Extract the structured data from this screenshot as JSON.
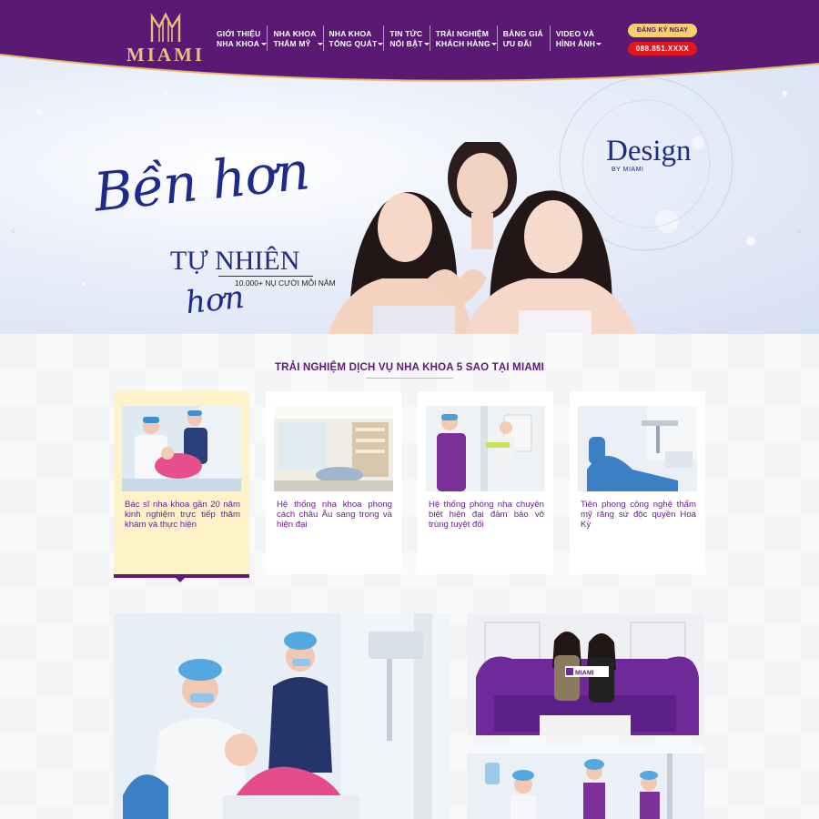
{
  "brand": {
    "name": "MIAMI",
    "gold": "#e6c07a",
    "purple": "#5b1b78"
  },
  "nav": [
    {
      "line1": "GIỚI THIỆU",
      "line2": "NHA KHOA",
      "caret": true
    },
    {
      "line1": "NHA KHOA",
      "line2": "THẨM MỸ",
      "caret": true
    },
    {
      "line1": "NHA KHOA",
      "line2": "TỔNG QUÁT",
      "caret": true
    },
    {
      "line1": "TIN TỨC",
      "line2": "NỔI BẬT",
      "caret": true
    },
    {
      "line1": "TRẢI NGHIỆM",
      "line2": "KHÁCH HÀNG",
      "caret": true
    },
    {
      "line1": "BẢNG GIÁ",
      "line2": "ƯU ĐÃI",
      "caret": false
    },
    {
      "line1": "VIDEO VÀ",
      "line2": "HÌNH ẢNH",
      "caret": true
    }
  ],
  "cta": {
    "register": "ĐĂNG KÝ NGAY",
    "phone": "088.851.XXXX"
  },
  "hero": {
    "script_top": "Bền hơn",
    "headline": "TỰ NHIÊN",
    "sub": "10.000+ NỤ CƯỜI MỖI NĂM",
    "script_bottom": "hơn",
    "design": "Design",
    "design_by": "BY MIAMI",
    "arrow_left": "‹",
    "arrow_right": "›"
  },
  "section": {
    "title": "TRẢI NGHIỆM DỊCH VỤ NHA KHOA 5 SAO TẠI MIAMI",
    "cards": [
      {
        "text": "Bác sĩ nha khoa gần 20 năm kinh nghiệm trực tiếp thăm khám và thực hiện",
        "active": true
      },
      {
        "text": "Hệ thống nha khoa phong cách châu Âu sang trọng và hiện đại",
        "active": false
      },
      {
        "text": "Hệ thống phòng nha chuyên biệt hiện đại đảm bảo vô trùng tuyệt đối",
        "active": false
      },
      {
        "text": "Tiên phong công nghệ thẩm mỹ răng sứ độc quyền Hoa Kỳ",
        "active": false
      }
    ]
  },
  "photo_sign": "MIAMI"
}
